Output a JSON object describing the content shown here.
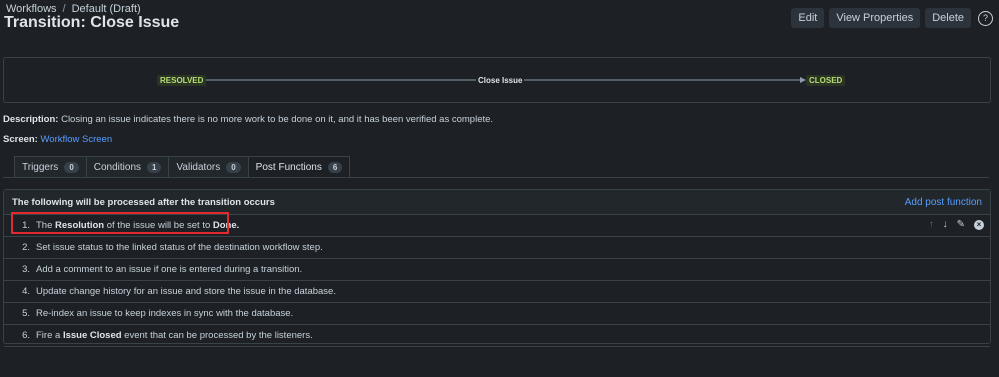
{
  "breadcrumb": {
    "root": "Workflows",
    "separator": "/",
    "current": "Default (Draft)"
  },
  "page_title": "Transition: Close Issue",
  "actions": {
    "edit": "Edit",
    "view_properties": "View Properties",
    "delete": "Delete",
    "help": "?"
  },
  "diagram": {
    "from_status": "RESOLVED",
    "transition": "Close Issue",
    "to_status": "CLOSED"
  },
  "description": {
    "label": "Description:",
    "text": " Closing an issue indicates there is no more work to be done on it, and it has been verified as complete."
  },
  "screen": {
    "label": "Screen:",
    "value": "Workflow Screen"
  },
  "tabs": [
    {
      "label": "Triggers",
      "count": "0"
    },
    {
      "label": "Conditions",
      "count": "1"
    },
    {
      "label": "Validators",
      "count": "0"
    },
    {
      "label": "Post Functions",
      "count": "6"
    }
  ],
  "post_functions": {
    "header": "The following will be processed after the transition occurs",
    "add_label": "Add post function",
    "rows": [
      {
        "num": "1.",
        "pre": "The ",
        "b1": "Resolution",
        "mid": " of the issue will be set to ",
        "b2": "Done",
        "post": "."
      },
      {
        "num": "2.",
        "pre": "Set issue status to the linked status of the destination workflow step."
      },
      {
        "num": "3.",
        "pre": "Add a comment to an issue if one is entered during a transition."
      },
      {
        "num": "4.",
        "pre": "Update change history for an issue and store the issue in the database."
      },
      {
        "num": "5.",
        "pre": "Re-index an issue to keep indexes in sync with the database."
      },
      {
        "num": "6.",
        "pre": "Fire a ",
        "b1": "Issue Closed",
        "mid": " event that can be processed by the listeners."
      }
    ]
  },
  "row_action_icons": [
    "arrow-up-icon",
    "arrow-down-icon",
    "pencil-icon",
    "close-icon"
  ]
}
